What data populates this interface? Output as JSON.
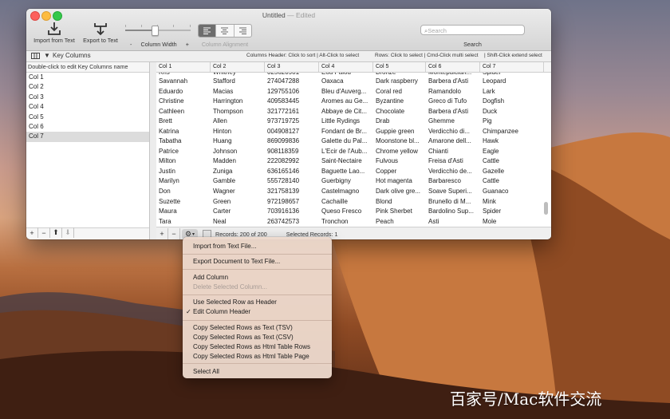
{
  "window": {
    "title": "Untitled",
    "title_suffix": "— Edited"
  },
  "toolbar": {
    "import_label": "Import from Text",
    "export_label": "Export to Text",
    "width_minus": "-",
    "width_label": "Column Width",
    "width_plus": "+",
    "width_level": 0.45,
    "alignment_label": "Column Alignment",
    "alignment_selected": "left",
    "search_placeholder": "Search",
    "search_label": "Search"
  },
  "keybar": {
    "label": "Key Columns",
    "hint_header": "Columns Header: Click to sort | Alt-Click to select",
    "hint_rows": "Rows: Click to select | Cmd-Click multi select",
    "hint_shift": "| Shift-Click extend select"
  },
  "left_pane": {
    "hint": "Double-click to edit Key Columns name",
    "items": [
      "Col 1",
      "Col 2",
      "Col 3",
      "Col 4",
      "Col 5",
      "Col 6",
      "Col 7"
    ],
    "selected_index": 6
  },
  "table": {
    "columns": [
      "Col 1",
      "Col 2",
      "Col 3",
      "Col 4",
      "Col 5",
      "Col 6",
      "Col 7"
    ],
    "partial_row": [
      "Kris",
      "Whitney",
      "025620901",
      "Eou Palou",
      "Bronze",
      "Montepulcian...",
      "Spider"
    ],
    "rows": [
      [
        "Savannah",
        "Stafford",
        "274047288",
        "Oaxaca",
        "Dark raspberry",
        "Barbera d'Asti",
        "Leopard"
      ],
      [
        "Eduardo",
        "Macias",
        "129755106",
        "Bleu d'Auverg...",
        "Coral red",
        "Ramandolo",
        "Lark"
      ],
      [
        "Christine",
        "Harrington",
        "409583445",
        "Aromes au Ge...",
        "Byzantine",
        "Greco di Tufo",
        "Dogfish"
      ],
      [
        "Cathleen",
        "Thompson",
        "321772161",
        "Abbaye de Cit...",
        "Chocolate",
        "Barbera d'Asti",
        "Duck"
      ],
      [
        "Brett",
        "Allen",
        "973719725",
        "Little Rydings",
        "Drab",
        "Ghemme",
        "Pig"
      ],
      [
        "Katrina",
        "Hinton",
        "004908127",
        "Fondant de Br...",
        "Guppie green",
        "Verdicchio di...",
        "Chimpanzee"
      ],
      [
        "Tabatha",
        "Huang",
        "869099836",
        "Galette du Pal...",
        "Moonstone bl...",
        "Amarone dell...",
        "Hawk"
      ],
      [
        "Patrice",
        "Johnson",
        "908118359",
        "L'Ecir de l'Aub...",
        "Chrome yellow",
        "Chianti",
        "Eagle"
      ],
      [
        "Milton",
        "Madden",
        "222082992",
        "Saint-Nectaire",
        "Fulvous",
        "Freisa d'Asti",
        "Cattle"
      ],
      [
        "Justin",
        "Zuniga",
        "636165146",
        "Baguette Lao...",
        "Copper",
        "Verdicchio de...",
        "Gazelle"
      ],
      [
        "Marilyn",
        "Gamble",
        "555728140",
        "Guerbigny",
        "Hot magenta",
        "Barbaresco",
        "Cattle"
      ],
      [
        "Don",
        "Wagner",
        "321758139",
        "Castelmagno",
        "Dark olive gre...",
        "Soave Superi...",
        "Guanaco"
      ],
      [
        "Suzette",
        "Green",
        "972198657",
        "Cachaille",
        "Blond",
        "Brunello di M...",
        "Mink"
      ],
      [
        "Maura",
        "Carter",
        "703916136",
        "Queso Fresco",
        "Pink Sherbet",
        "Bardolino Sup...",
        "Spider"
      ],
      [
        "Tara",
        "Neal",
        "263742573",
        "Tronchon",
        "Peach",
        "Asti",
        "Mole"
      ]
    ],
    "records_label": "Records: 200 of 200",
    "selected_label": "Selected Records: 1"
  },
  "menu": {
    "import": "Import  from Text File...",
    "export": "Export Document to Text File...",
    "add_column": "Add Column",
    "delete_column": "Delete Selected Column...",
    "use_header": "Use Selected Row as Header",
    "edit_header": "Edit Column Header",
    "edit_header_check": "✓",
    "copy_tsv": "Copy Selected Rows as Text (TSV)",
    "copy_csv": "Copy Selected Rows as Text (CSV)",
    "copy_html_rows": "Copy Selected Rows as Html Table Rows",
    "copy_html_page": "Copy Selected Rows as Html Table Page",
    "select_all": "Select All"
  },
  "watermark": "百家号/Mac软件交流",
  "colors": {
    "close": "#fc605c",
    "minimize": "#fdbc40",
    "zoom": "#34c84a",
    "selection": "#dcdcdc"
  }
}
